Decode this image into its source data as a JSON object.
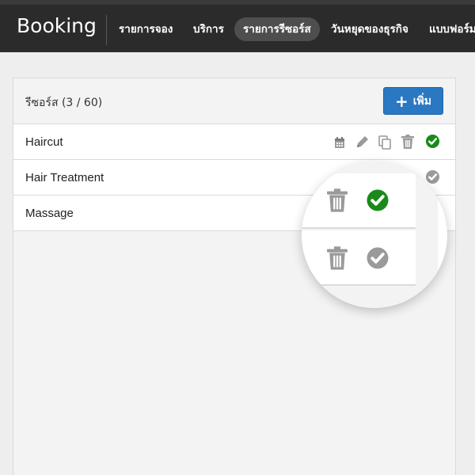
{
  "app": {
    "title": "Booking"
  },
  "nav": {
    "items": [
      {
        "label": "รายการจอง",
        "active": false
      },
      {
        "label": "บริการ",
        "active": false
      },
      {
        "label": "รายการรีซอร์ส",
        "active": true
      },
      {
        "label": "วันหยุดของธุรกิจ",
        "active": false
      },
      {
        "label": "แบบฟอร์ม",
        "active": false
      }
    ]
  },
  "panel": {
    "title": "รีซอร์ส (3 / 60)",
    "add_label": "เพิ่ม"
  },
  "resources": [
    {
      "name": "Haircut",
      "enabled": true
    },
    {
      "name": "Hair Treatment",
      "enabled": false
    },
    {
      "name": "Massage",
      "enabled": false
    }
  ],
  "colors": {
    "topbar": "#2b2b2b",
    "accent": "#2a78c2",
    "enabled_check": "#1a8a1a",
    "disabled_check": "#9a9a9a",
    "action_icon": "#9a9a9a"
  },
  "icons": {
    "row_actions": [
      "calendar-icon",
      "edit-icon",
      "copy-icon",
      "trash-icon"
    ],
    "status": "check-circle-icon"
  }
}
